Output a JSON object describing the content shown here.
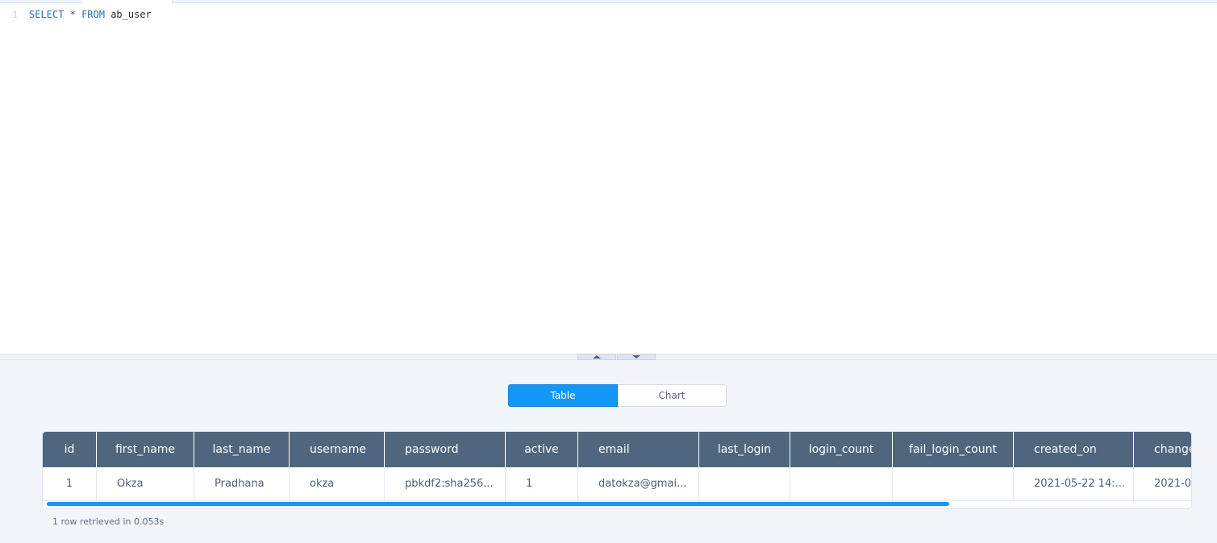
{
  "editor": {
    "line_number": "1",
    "tokens": {
      "select": "SELECT",
      "star": "*",
      "from": "FROM",
      "table": "ab_user"
    }
  },
  "resizer": {
    "up_icon": "triangle-up-icon",
    "down_icon": "triangle-down-icon"
  },
  "view_toggle": {
    "table_label": "Table",
    "chart_label": "Chart",
    "selected": "Table"
  },
  "results": {
    "columns": [
      {
        "label": "id"
      },
      {
        "label": "first_name"
      },
      {
        "label": "last_name"
      },
      {
        "label": "username"
      },
      {
        "label": "password"
      },
      {
        "label": "active"
      },
      {
        "label": "email"
      },
      {
        "label": "last_login"
      },
      {
        "label": "login_count"
      },
      {
        "label": "fail_login_count"
      },
      {
        "label": "created_on"
      },
      {
        "label": "change"
      }
    ],
    "rows": [
      [
        "1",
        "Okza",
        "Pradhana",
        "okza",
        "pbkdf2:sha256...",
        "1",
        "datokza@gmai...",
        "",
        "",
        "",
        "2021-05-22 14:...",
        "2021-0"
      ]
    ],
    "status": "1 row retrieved in 0.053s"
  },
  "colors": {
    "accent": "#1497f8",
    "header_bg": "#50667f",
    "pane_bg": "#f2f5fa"
  }
}
